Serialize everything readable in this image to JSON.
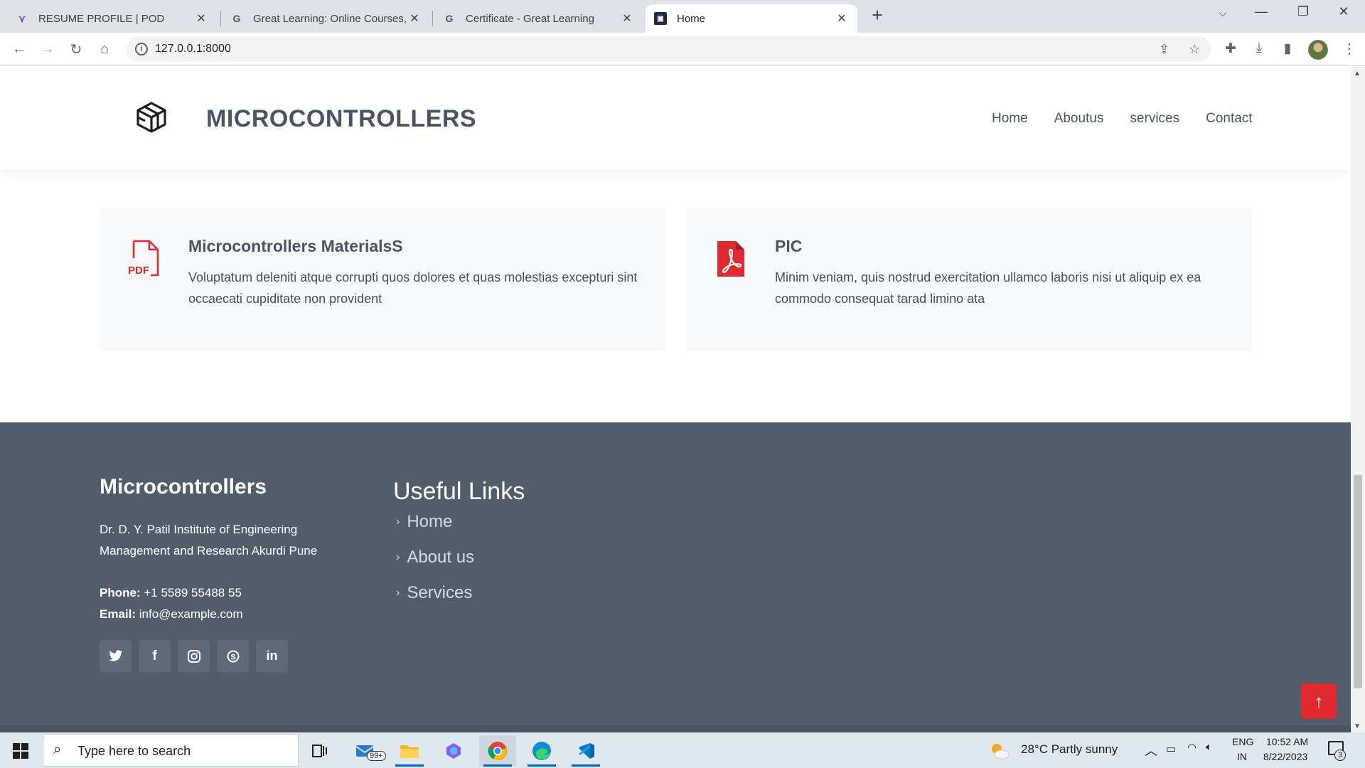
{
  "browser": {
    "tabs": [
      {
        "title": "RESUME PROFILE | POD",
        "icon": "pod-icon"
      },
      {
        "title": "Great Learning: Online Courses, P",
        "icon": "google-g-icon"
      },
      {
        "title": "Certificate - Great Learning",
        "icon": "google-g-icon"
      },
      {
        "title": "Home",
        "icon": "site-favicon"
      }
    ],
    "url": "127.0.0.1:8000"
  },
  "site": {
    "brand": "MICROCONTROLLERS",
    "nav": [
      "Home",
      "Aboutus",
      "services",
      "Contact"
    ],
    "cards": [
      {
        "title": "Microcontrollers MaterialsS",
        "text": "Voluptatum deleniti atque corrupti quos dolores et quas molestias excepturi sint occaecati cupiditate non provident",
        "icon": "pdf-file-icon",
        "icon_label": "PDF"
      },
      {
        "title": "PIC",
        "text": "Minim veniam, quis nostrud exercitation ullamco laboris nisi ut aliquip ex ea commodo consequat tarad limino ata",
        "icon": "acrobat-pdf-icon"
      }
    ],
    "footer": {
      "title": "Microcontrollers",
      "address": "Dr. D. Y. Patil Institute of Engineering Management and Research Akurdi Pune",
      "phone_label": "Phone:",
      "phone": "+1 5589 55488 55",
      "email_label": "Email:",
      "email": "info@example.com",
      "social": [
        "twitter-icon",
        "facebook-icon",
        "instagram-icon",
        "skype-icon",
        "linkedin-icon"
      ],
      "links_title": "Useful Links",
      "links": [
        "Home",
        "About us",
        "Services"
      ]
    }
  },
  "taskbar": {
    "search_placeholder": "Type here to search",
    "mail_badge": "99+",
    "weather": "28°C  Partly sunny",
    "lang_top": "ENG",
    "lang_bottom": "IN",
    "time": "10:52 AM",
    "date": "8/22/2023",
    "notifications": "3"
  },
  "colors": {
    "footer_bg": "#525d6b",
    "accent_red": "#e02a2f",
    "text_dark": "#4a5463"
  }
}
